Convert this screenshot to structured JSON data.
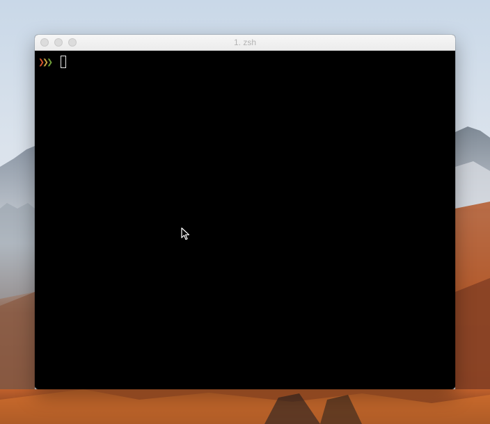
{
  "window": {
    "title": "1. zsh"
  },
  "terminal": {
    "prompt_symbols": [
      {
        "glyph": "❯",
        "color": "#d3542c",
        "icon": "chevron-right-icon"
      },
      {
        "glyph": "❯",
        "color": "#c7a241",
        "icon": "chevron-right-icon"
      },
      {
        "glyph": "❯",
        "color": "#6f9f3a",
        "icon": "chevron-right-icon"
      }
    ],
    "input_value": "",
    "background": "#000000"
  },
  "colors": {
    "titlebar": "#ececec",
    "title_text": "#b3b3b3",
    "traffic_light_inactive": "#dcdcdc"
  }
}
